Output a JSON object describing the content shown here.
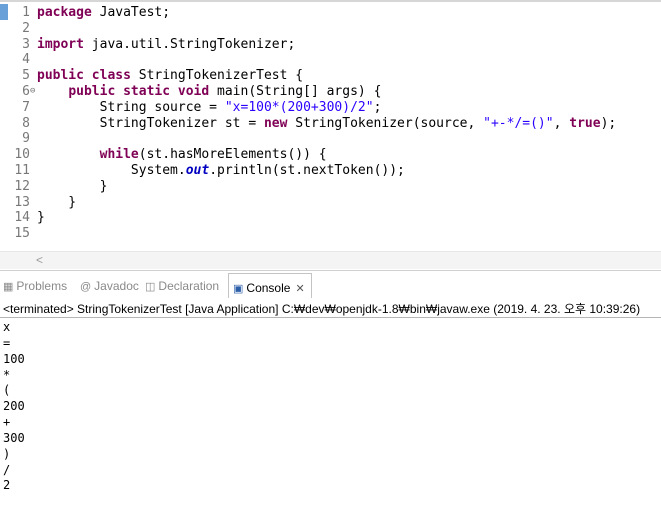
{
  "editor": {
    "lines": [
      {
        "no": "1",
        "ann": "",
        "parts": [
          {
            "t": "kw",
            "v": "package"
          },
          {
            "t": "n",
            "v": " JavaTest;"
          }
        ]
      },
      {
        "no": "2",
        "ann": "",
        "parts": []
      },
      {
        "no": "3",
        "ann": "",
        "parts": [
          {
            "t": "kw",
            "v": "import"
          },
          {
            "t": "n",
            "v": " java.util.StringTokenizer;"
          }
        ]
      },
      {
        "no": "4",
        "ann": "",
        "parts": []
      },
      {
        "no": "5",
        "ann": "",
        "parts": [
          {
            "t": "kw",
            "v": "public class"
          },
          {
            "t": "n",
            "v": " StringTokenizerTest {"
          }
        ]
      },
      {
        "no": "6",
        "ann": "⊖",
        "parts": [
          {
            "t": "n",
            "v": "    "
          },
          {
            "t": "kw",
            "v": "public static void"
          },
          {
            "t": "n",
            "v": " main(String[] args) {"
          }
        ]
      },
      {
        "no": "7",
        "ann": "",
        "parts": [
          {
            "t": "n",
            "v": "        String source = "
          },
          {
            "t": "str",
            "v": "\"x=100*(200+300)/2\""
          },
          {
            "t": "n",
            "v": ";"
          }
        ]
      },
      {
        "no": "8",
        "ann": "",
        "parts": [
          {
            "t": "n",
            "v": "        StringTokenizer st = "
          },
          {
            "t": "kw",
            "v": "new"
          },
          {
            "t": "n",
            "v": " StringTokenizer(source, "
          },
          {
            "t": "str",
            "v": "\"+-*/=()\""
          },
          {
            "t": "n",
            "v": ", "
          },
          {
            "t": "kw",
            "v": "true"
          },
          {
            "t": "n",
            "v": ");"
          }
        ]
      },
      {
        "no": "9",
        "ann": "",
        "parts": []
      },
      {
        "no": "10",
        "ann": "",
        "parts": [
          {
            "t": "n",
            "v": "        "
          },
          {
            "t": "kw",
            "v": "while"
          },
          {
            "t": "n",
            "v": "(st.hasMoreElements()) {"
          }
        ]
      },
      {
        "no": "11",
        "ann": "",
        "parts": [
          {
            "t": "n",
            "v": "            System."
          },
          {
            "t": "sfld",
            "v": "out"
          },
          {
            "t": "n",
            "v": ".println(st.nextToken());"
          }
        ]
      },
      {
        "no": "12",
        "ann": "",
        "parts": [
          {
            "t": "n",
            "v": "        }"
          }
        ]
      },
      {
        "no": "13",
        "ann": "",
        "parts": [
          {
            "t": "n",
            "v": "    }"
          }
        ]
      },
      {
        "no": "14",
        "ann": "",
        "parts": [
          {
            "t": "n",
            "v": "}"
          }
        ]
      },
      {
        "no": "15",
        "ann": "",
        "parts": []
      }
    ],
    "scroll_arrow": "<"
  },
  "tabs": [
    {
      "name": "problems",
      "icon": "▦",
      "label": "Problems",
      "active": false
    },
    {
      "name": "javadoc",
      "icon": "@",
      "label": "Javadoc",
      "active": false
    },
    {
      "name": "declaration",
      "icon": "◫",
      "label": "Declaration",
      "active": false
    },
    {
      "name": "console",
      "icon": "▣",
      "label": "Console",
      "active": true,
      "close": "✕"
    }
  ],
  "console": {
    "header": "<terminated> StringTokenizerTest [Java Application] C:₩dev₩openjdk-1.8₩bin₩javaw.exe (2019. 4. 23. 오후 10:39:26)",
    "output": [
      "x",
      "=",
      "100",
      "*",
      "(",
      "200",
      "+",
      "300",
      ")",
      "/",
      "2"
    ]
  },
  "icons": {
    "problems": "problems-icon",
    "javadoc": "javadoc-icon",
    "declaration": "declaration-icon",
    "console": "console-icon",
    "close": "close-icon",
    "collapse": "collapse-icon"
  },
  "colors": {
    "keyword": "#7f0055",
    "string": "#2a00ff",
    "static_field": "#0000c0",
    "line_number": "#787878",
    "marker": "#6aa0d8"
  }
}
